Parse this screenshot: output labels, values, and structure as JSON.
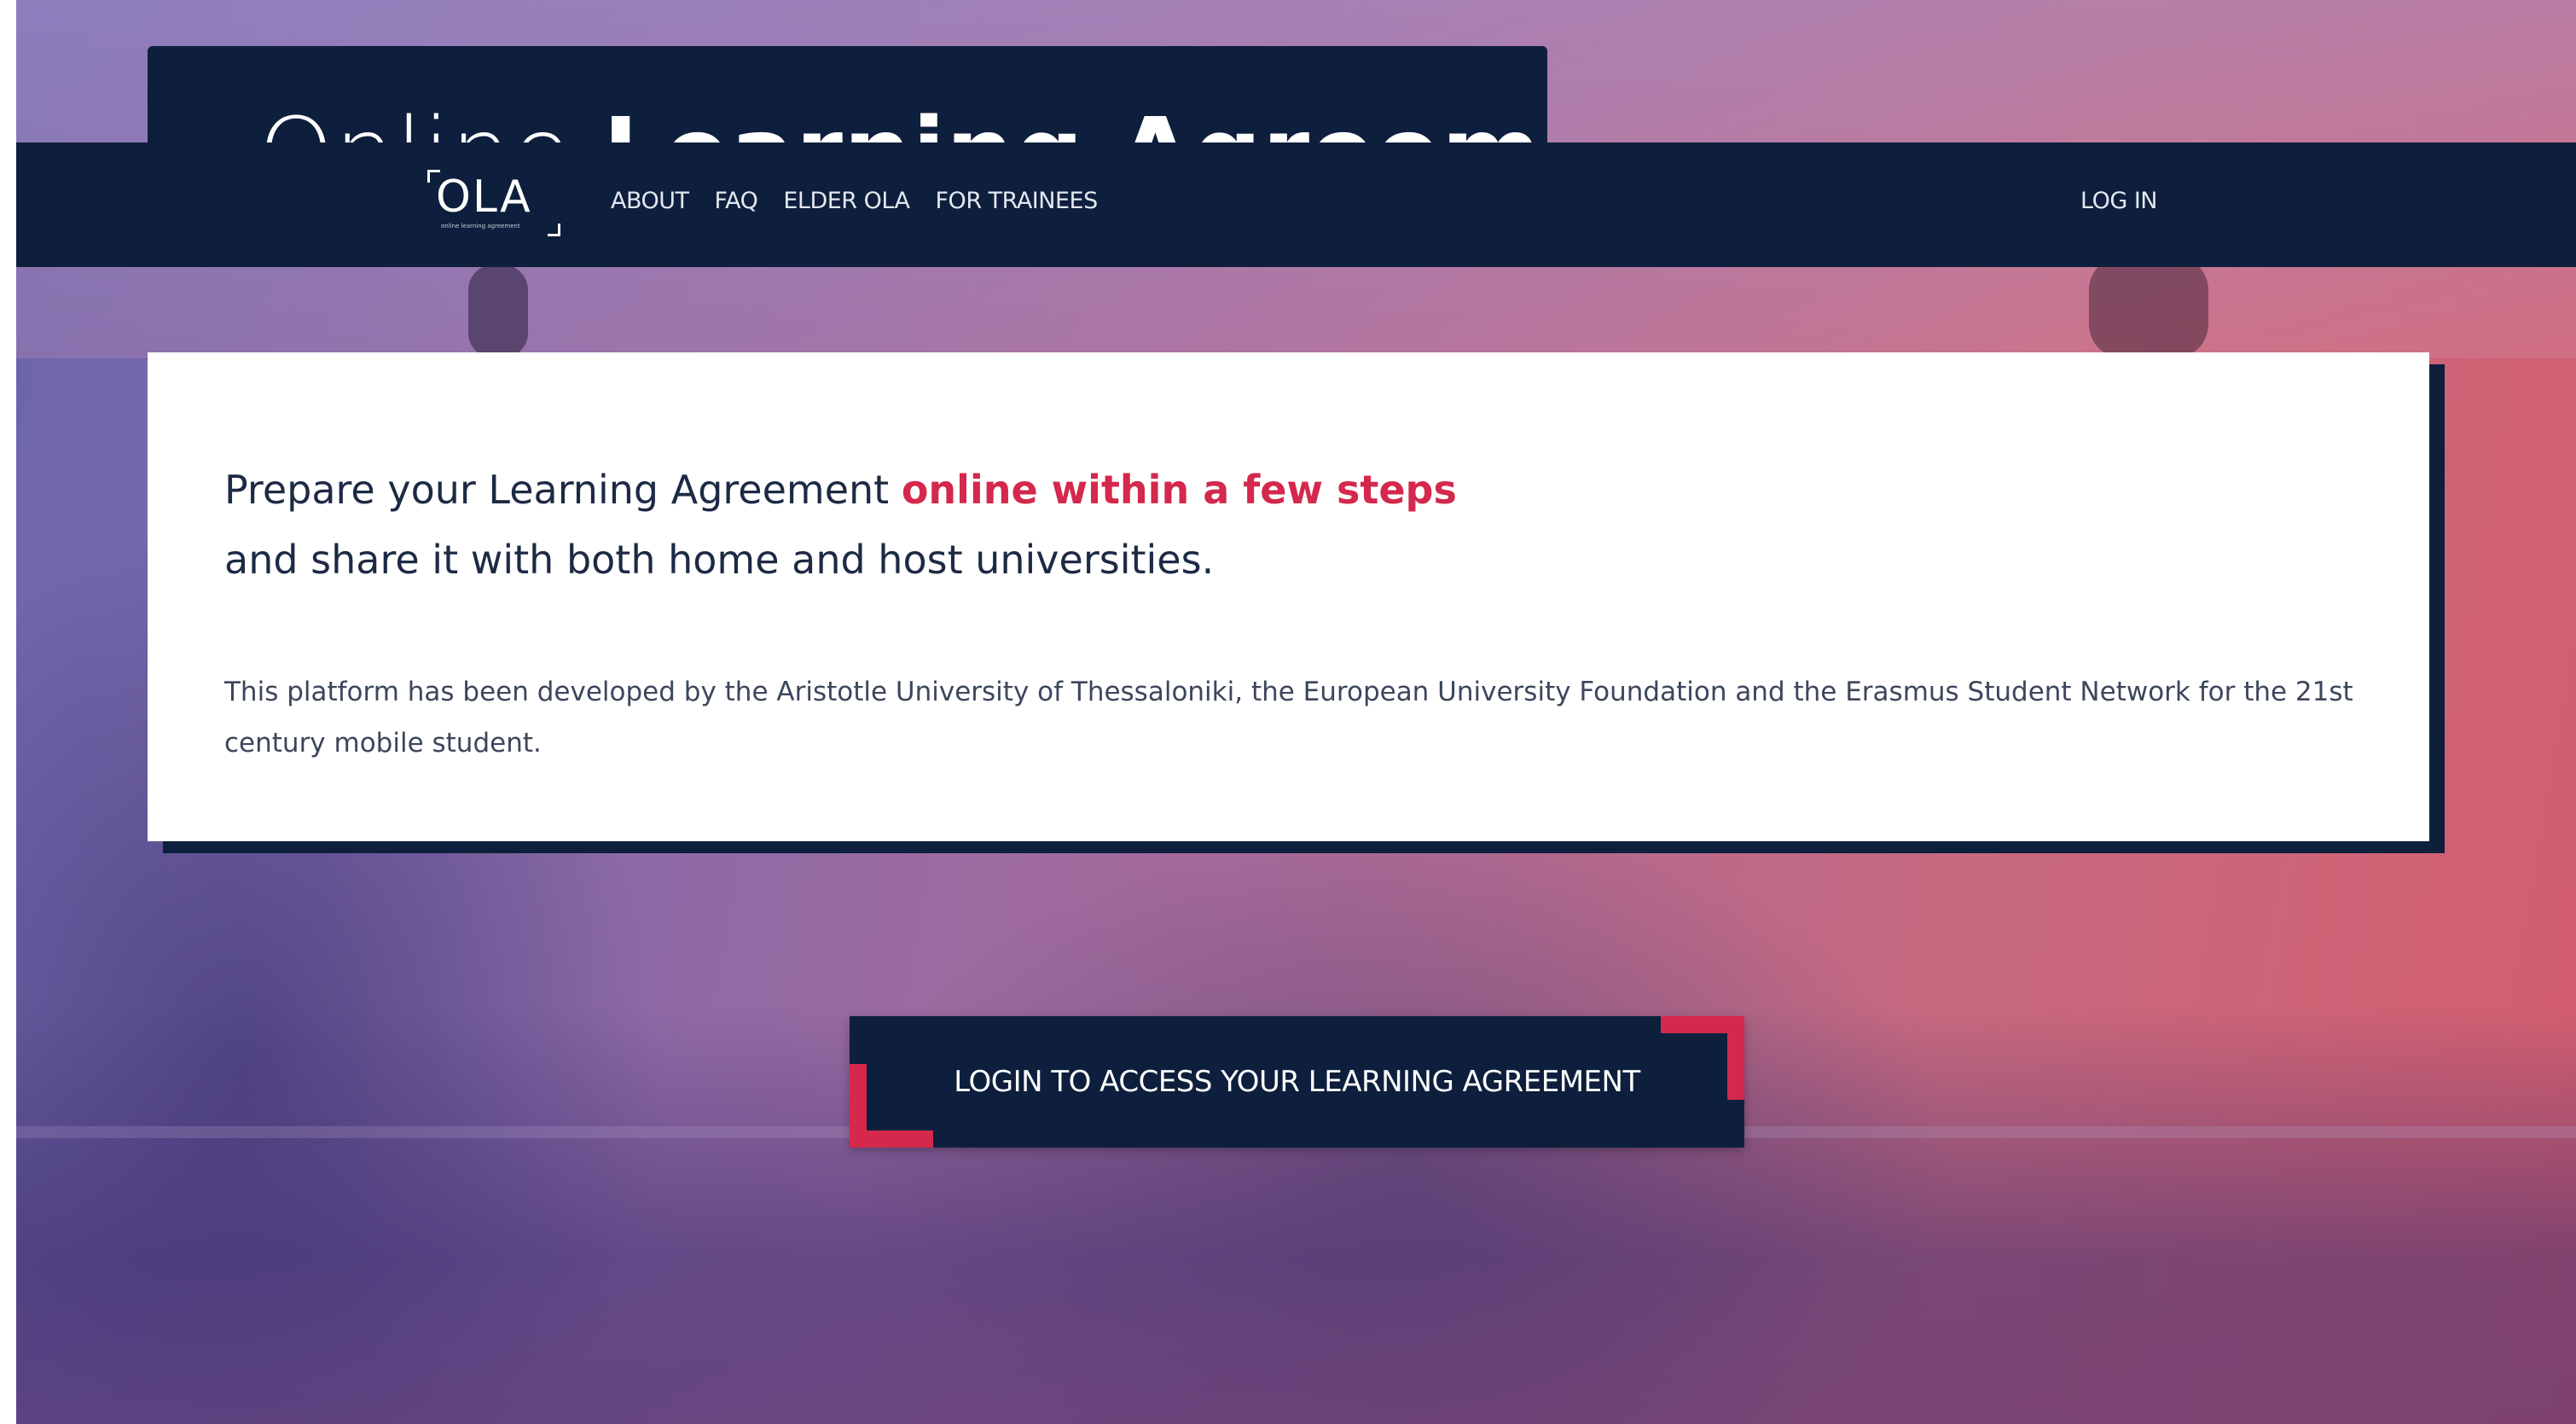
{
  "site": {
    "title_light": "Online",
    "title_bold": "Learning Agreement"
  },
  "logo": {
    "text": "OLA",
    "subtitle": "online learning agreement"
  },
  "nav": {
    "items": [
      {
        "label": "ABOUT"
      },
      {
        "label": "FAQ"
      },
      {
        "label": "ELDER OLA"
      },
      {
        "label": "FOR TRAINEES"
      }
    ],
    "login_label": "LOG IN"
  },
  "intro": {
    "headline_start": "Prepare your Learning Agreement ",
    "headline_accent": "online within a few steps",
    "headline_end": "and share it with both home and host universities.",
    "description": "This platform has been developed by the Aristotle University of Thessaloniki, the European University Foundation and the Erasmus Student Network for the 21st century mobile student."
  },
  "cta": {
    "label": "LOGIN TO ACCESS YOUR LEARNING AGREEMENT"
  },
  "colors": {
    "navy": "#0d1f3c",
    "accent": "#d4284d",
    "card": "#ffffff"
  },
  "icons": {
    "logo_brackets": "corner-bracket-icon",
    "cta_corners": "corner-bracket-icon"
  }
}
